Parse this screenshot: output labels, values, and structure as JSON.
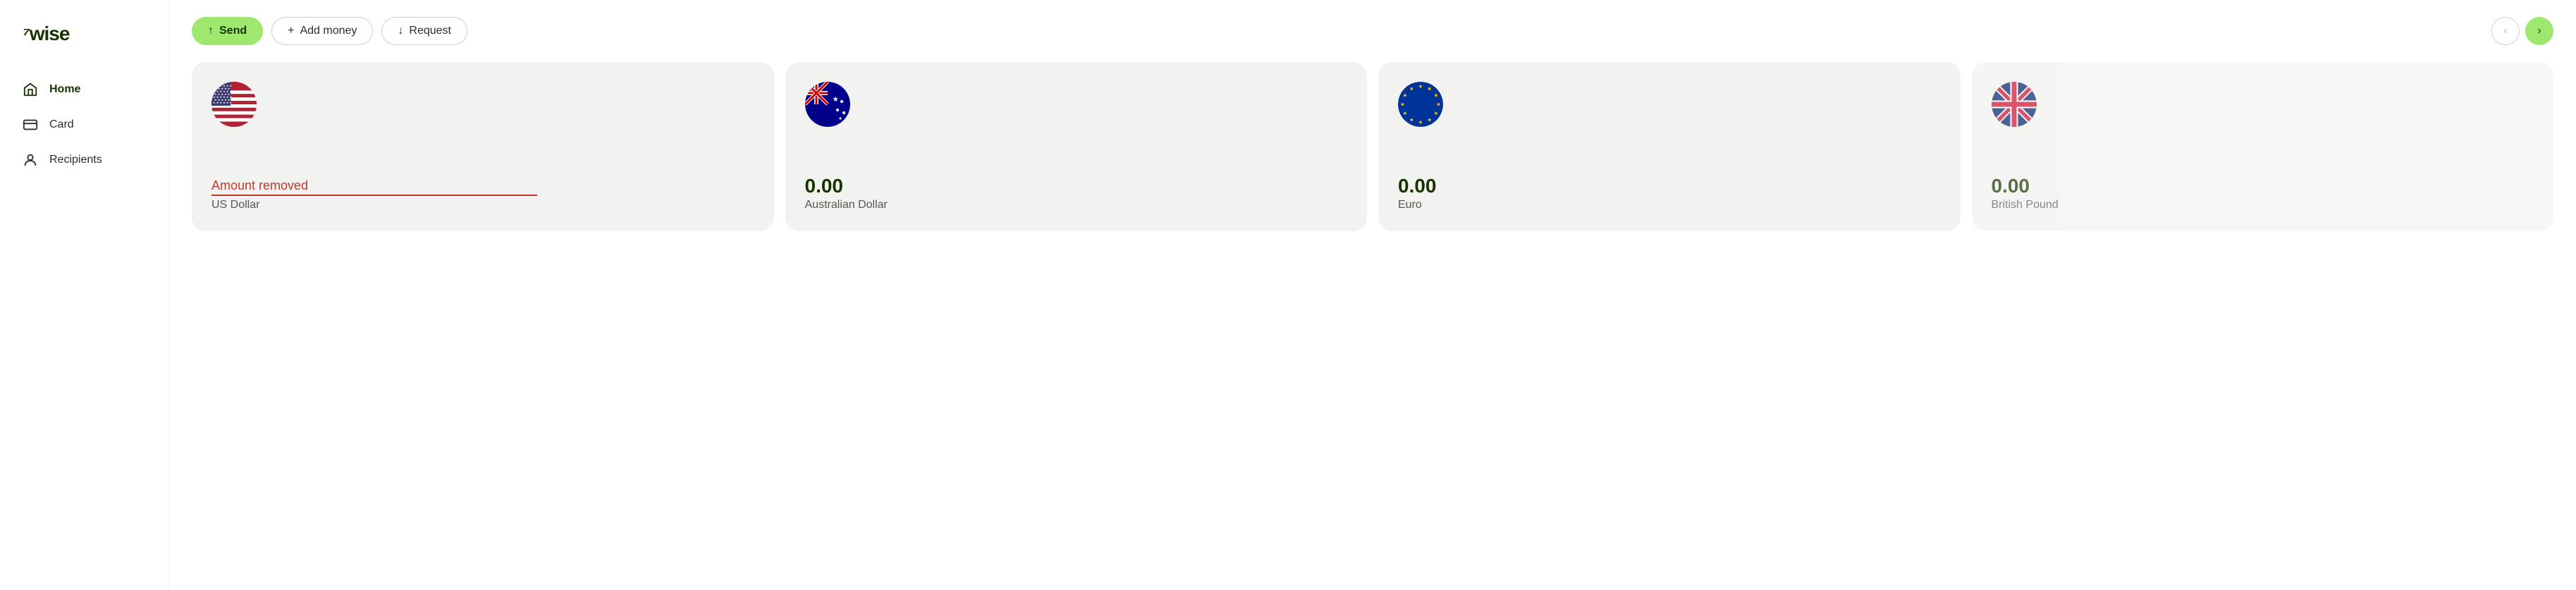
{
  "logo": {
    "arrow": "⁷",
    "text": "wise"
  },
  "sidebar": {
    "items": [
      {
        "id": "home",
        "label": "Home",
        "icon": "home-icon",
        "active": true
      },
      {
        "id": "card",
        "label": "Card",
        "icon": "card-icon",
        "active": false
      },
      {
        "id": "recipients",
        "label": "Recipients",
        "icon": "recipients-icon",
        "active": false
      }
    ]
  },
  "actions": {
    "send": {
      "label": "Send",
      "icon": "↑"
    },
    "add_money": {
      "label": "Add money",
      "icon": "+"
    },
    "request": {
      "label": "Request",
      "icon": "↓"
    }
  },
  "nav_prev_label": "‹",
  "nav_next_label": "›",
  "currencies": [
    {
      "id": "usd",
      "amount_removed_label": "Amount removed",
      "amount": null,
      "currency_name": "US Dollar",
      "flag": "us"
    },
    {
      "id": "aud",
      "amount": "0.00",
      "currency_name": "Australian Dollar",
      "flag": "au"
    },
    {
      "id": "eur",
      "amount": "0.00",
      "currency_name": "Euro",
      "flag": "eu"
    },
    {
      "id": "gbp",
      "amount": "0.00",
      "currency_name": "British Pound",
      "flag": "gb"
    }
  ]
}
